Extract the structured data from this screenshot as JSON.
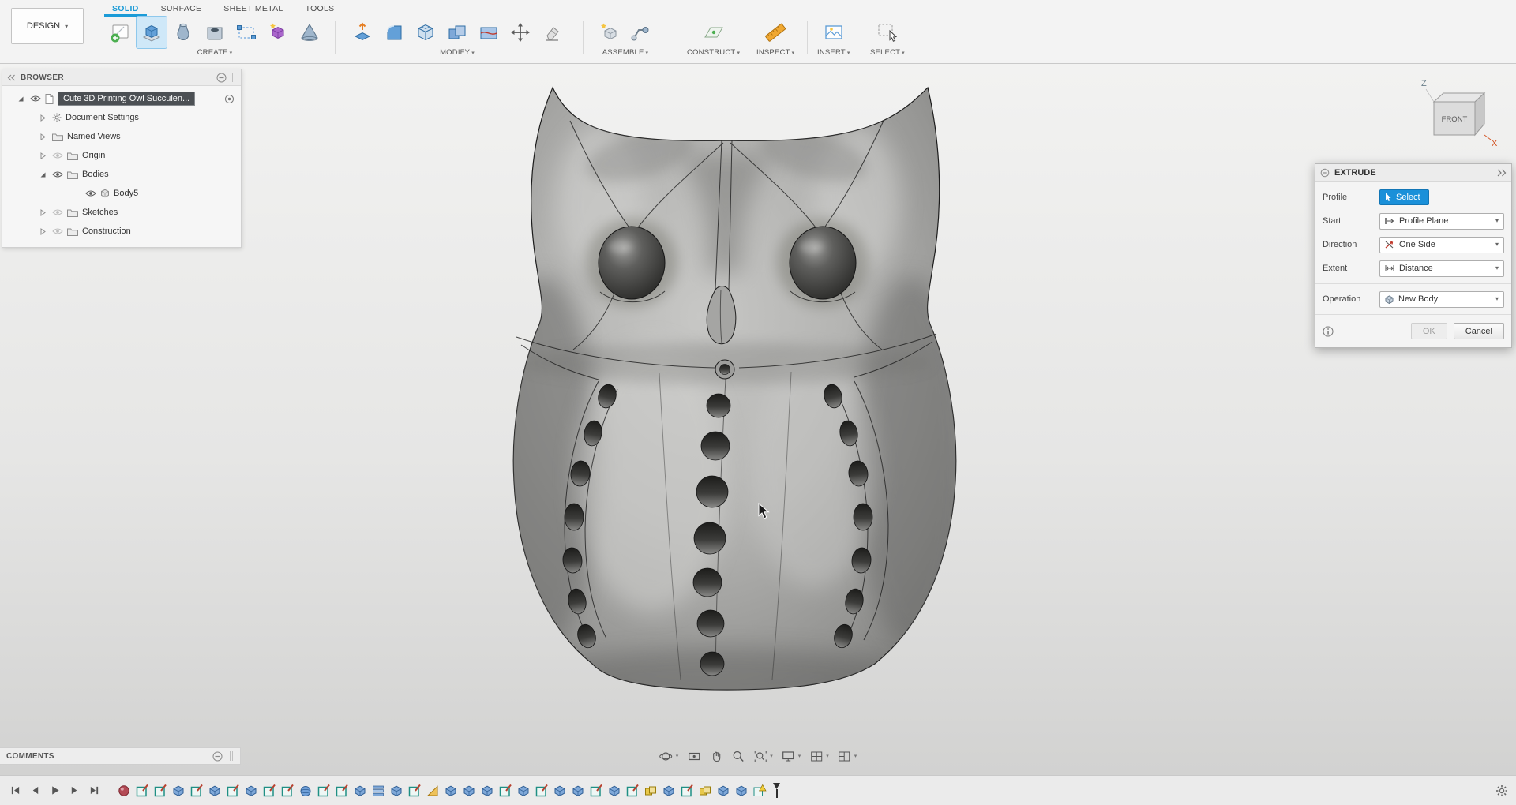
{
  "topbar": {
    "design_label": "DESIGN",
    "tabs": [
      {
        "label": "SOLID",
        "active": true
      },
      {
        "label": "SURFACE",
        "active": false
      },
      {
        "label": "SHEET METAL",
        "active": false
      },
      {
        "label": "TOOLS",
        "active": false
      }
    ],
    "groups": {
      "create": "CREATE",
      "modify": "MODIFY",
      "assemble": "ASSEMBLE",
      "construct": "CONSTRUCT",
      "inspect": "INSPECT",
      "insert": "INSERT",
      "select": "SELECT"
    }
  },
  "browser": {
    "title": "BROWSER",
    "root_label": "Cute 3D Printing Owl Succulen...",
    "items": [
      {
        "label": "Document Settings",
        "icon": "gear",
        "expand": "collapsed",
        "eye": "none",
        "indent": 1
      },
      {
        "label": "Named Views",
        "icon": "folder",
        "expand": "collapsed",
        "eye": "none",
        "indent": 1
      },
      {
        "label": "Origin",
        "icon": "folder",
        "expand": "collapsed",
        "eye": "off",
        "indent": 1
      },
      {
        "label": "Bodies",
        "icon": "folder",
        "expand": "expanded",
        "eye": "on",
        "indent": 1
      },
      {
        "label": "Body5",
        "icon": "body",
        "expand": "none",
        "eye": "on",
        "indent": 2
      },
      {
        "label": "Sketches",
        "icon": "folder",
        "expand": "collapsed",
        "eye": "off",
        "indent": 1
      },
      {
        "label": "Construction",
        "icon": "folder",
        "expand": "collapsed",
        "eye": "off",
        "indent": 1
      }
    ]
  },
  "dialog": {
    "title": "EXTRUDE",
    "rows": {
      "profile_label": "Profile",
      "profile_value": "Select",
      "start_label": "Start",
      "start_value": "Profile Plane",
      "direction_label": "Direction",
      "direction_value": "One Side",
      "extent_label": "Extent",
      "extent_value": "Distance",
      "operation_label": "Operation",
      "operation_value": "New Body"
    },
    "ok_label": "OK",
    "cancel_label": "Cancel"
  },
  "viewcube": {
    "front_label": "FRONT",
    "z_label": "Z",
    "x_label": "X"
  },
  "comments_label": "COMMENTS",
  "timeline": {
    "features": [
      "appearance",
      "sketch",
      "sketch",
      "feature",
      "sketch",
      "feature",
      "sketch",
      "feature",
      "sketch",
      "sketch",
      "sphere",
      "sketch",
      "sketch",
      "feature",
      "pattern",
      "feature",
      "sketch",
      "draft",
      "feature",
      "feature",
      "feature",
      "sketch",
      "feature",
      "sketch",
      "feature",
      "feature",
      "sketch",
      "feature",
      "sketch",
      "combine",
      "feature",
      "sketch",
      "combine",
      "feature",
      "feature",
      "warning"
    ]
  },
  "colors": {
    "accent_blue": "#1b9bd7",
    "select_button": "#1a90d9"
  }
}
